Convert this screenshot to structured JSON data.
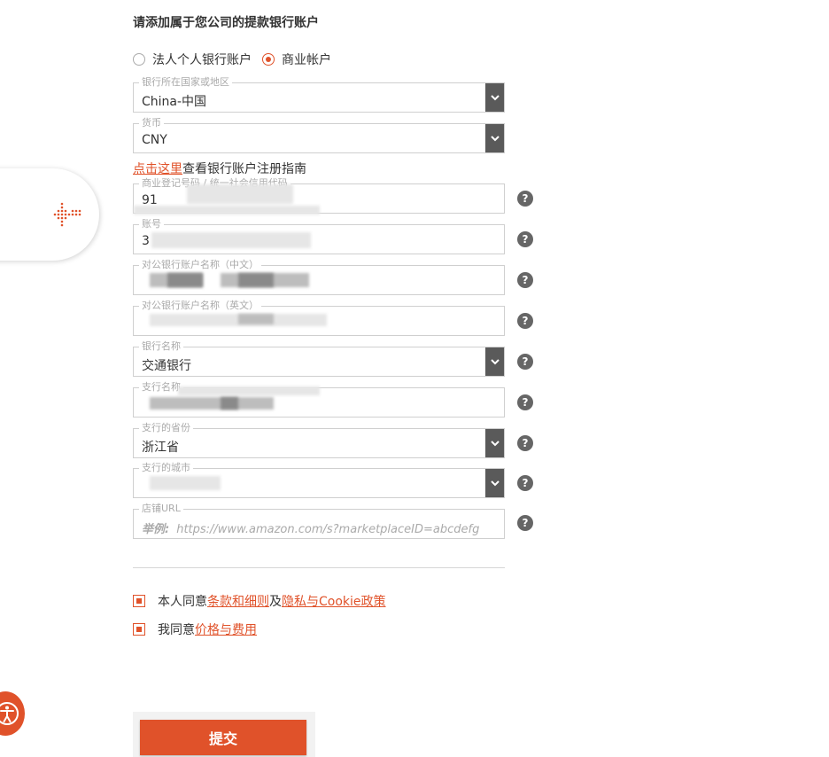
{
  "heading": "请添加属于您公司的提款银行账户",
  "account_type": {
    "options": [
      {
        "label": "法人个人银行账户",
        "checked": false
      },
      {
        "label": "商业帐户",
        "checked": true
      }
    ]
  },
  "fields": {
    "country": {
      "legend": "银行所在国家或地区",
      "value": "China-中国"
    },
    "currency": {
      "legend": "货币",
      "value": "CNY"
    },
    "reg_no": {
      "legend": "商业登记号码 / 统一社会信用代码",
      "value": "91"
    },
    "account_no": {
      "legend": "账号",
      "value": "3"
    },
    "name_cn": {
      "legend": "对公银行账户名称（中文）",
      "value": ""
    },
    "name_en": {
      "legend": "对公银行账户名称（英文）",
      "value": ""
    },
    "bank_name": {
      "legend": "银行名称",
      "value": "交通银行"
    },
    "branch_name": {
      "legend": "支行名称",
      "value": ""
    },
    "branch_province": {
      "legend": "支行的省份",
      "value": "浙江省"
    },
    "branch_city": {
      "legend": "支行的城市",
      "value": ""
    },
    "store_url": {
      "legend": "店铺URL",
      "placeholder_prefix": "举例:",
      "placeholder": "https://www.amazon.com/s?marketplaceID=abcdefg"
    }
  },
  "guide": {
    "link": "点击这里",
    "text": "查看银行账户注册指南"
  },
  "help_icon_glyph": "?",
  "agreements": [
    {
      "prefix": "本人同意",
      "link1": "条款和细则",
      "middle": "及",
      "link2": "隐私与Cookie政策"
    },
    {
      "prefix": "我同意",
      "link1": "价格与费用"
    }
  ],
  "submit_label": "提交",
  "colors": {
    "accent": "#e0522a",
    "dropdown": "#5a5a5a",
    "help": "#666666"
  },
  "icons": {
    "dropdown": "chevron-down-icon",
    "help": "question-icon",
    "side": "dotted-cursor-icon",
    "accessibility": "accessibility-icon"
  }
}
